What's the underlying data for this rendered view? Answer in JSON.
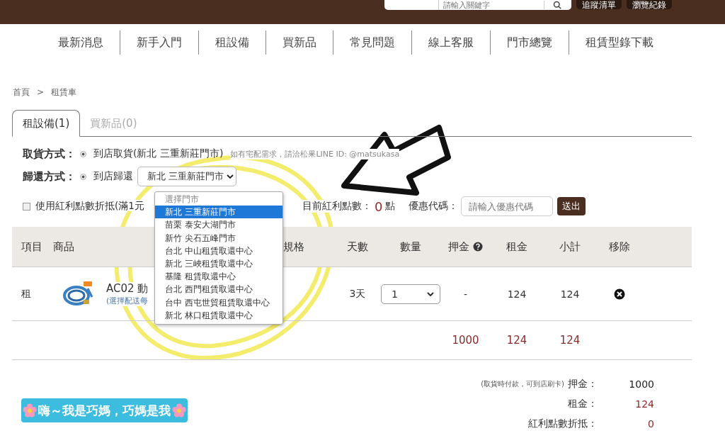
{
  "header": {
    "search_placeholder": "請輸入關鍵字",
    "buttons": [
      "追蹤清單",
      "瀏覽紀錄"
    ]
  },
  "nav": [
    "最新消息",
    "新手入門",
    "租設備",
    "買新品",
    "常見問題",
    "線上客服",
    "門市總覽",
    "租賃型錄下載"
  ],
  "breadcrumb": {
    "items": [
      "首頁",
      "租賃車"
    ],
    "separator": ">"
  },
  "tabs": [
    {
      "label": "租設備(1)",
      "selected": true
    },
    {
      "label": "買新品(0)",
      "selected": false
    }
  ],
  "pickup": {
    "label": "取貨方式：",
    "option": "到店取貨(新北 三重新莊門市)",
    "selected": true,
    "note": "如有宅配需求，請洽松果LINE ID: @matsukasa"
  },
  "return": {
    "label": "歸還方式：",
    "option": "到店歸還",
    "selected": true,
    "store": "新北 三重新莊門市"
  },
  "points": {
    "checked": false,
    "label": "使用紅利點數折抵(滿1元",
    "balance_label": "目前紅利點數：",
    "balance": "0",
    "unit": "點"
  },
  "coupon": {
    "label": "優惠代碼：",
    "placeholder": "請輸入優惠代碼",
    "button": "送出"
  },
  "store_dropdown": [
    {
      "label": "選擇門市",
      "selected": false,
      "disabled": true
    },
    {
      "label": "新北 三重新莊門市",
      "selected": true,
      "disabled": false
    },
    {
      "label": "苗栗 泰安大湖門市",
      "selected": false,
      "disabled": false
    },
    {
      "label": "新竹 尖石五峰門市",
      "selected": false,
      "disabled": false
    },
    {
      "label": "台北 中山租賃取還中心",
      "selected": false,
      "disabled": false
    },
    {
      "label": "新北 三峽租賃取還中心",
      "selected": false,
      "disabled": false
    },
    {
      "label": "基隆 租賃取還中心",
      "selected": false,
      "disabled": false
    },
    {
      "label": "台北 西門租賃取還中心",
      "selected": false,
      "disabled": false
    },
    {
      "label": "台中 西屯世貿租賃取還中心",
      "selected": false,
      "disabled": false
    },
    {
      "label": "新北 林口租賃取還中心",
      "selected": false,
      "disabled": false
    }
  ],
  "table": {
    "columns": [
      "項目",
      "商品",
      "規格",
      "天數",
      "數量",
      "押金",
      "租金",
      "小計",
      "移除"
    ],
    "rows": [
      {
        "type": "租",
        "name": "AC02 動",
        "note": "(選擇配送每",
        "days": "3天",
        "quantity": "1",
        "deposit": "-",
        "rent": "124",
        "subtotal": "124"
      }
    ],
    "totals": {
      "deposit": "1000",
      "rent": "124",
      "subtotal": "124"
    }
  },
  "summary": [
    {
      "note": "(取貨時付款，可到店刷卡)",
      "label": "押金：",
      "value": "1000",
      "color": "#222222"
    },
    {
      "label": "租金：",
      "value": "124",
      "color": "#8b2a2a"
    },
    {
      "label": "紅利點數折抵：",
      "value": "0",
      "color": "#8b2a2a"
    }
  ],
  "sticker": {
    "text": "嗨～我是巧媽，巧媽是我"
  }
}
